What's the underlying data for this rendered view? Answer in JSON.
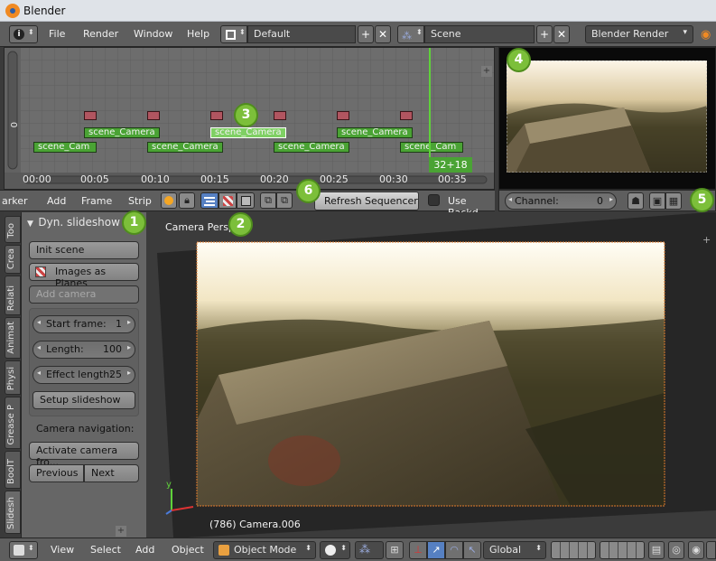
{
  "window": {
    "title": "Blender"
  },
  "info_header": {
    "menus": [
      "File",
      "Render",
      "Window",
      "Help"
    ],
    "screen_layout": "Default",
    "scene": "Scene",
    "render_engine": "Blender Render"
  },
  "sequencer": {
    "strip_label": "scene_Camera",
    "strip_label_short": "scene_Cam",
    "time_ticks": [
      "00:00",
      "00:05",
      "00:10",
      "00:15",
      "00:20",
      "00:25",
      "00:30",
      "00:35"
    ],
    "current_frame_label": "32+18",
    "channel_label": "0"
  },
  "sequencer_header": {
    "menus": [
      "arker",
      "Add",
      "Frame",
      "Strip"
    ],
    "refresh_label": "Refresh Sequencer",
    "use_backdrop_label": "Use Backd"
  },
  "preview_header": {
    "channel_label": "Channel:",
    "channel_value": "0"
  },
  "tool_shelf": {
    "tabs": [
      "Too",
      "Crea",
      "Relati",
      "Animat",
      "Physi",
      "Grease P",
      "BoolT",
      "Slidesh"
    ],
    "panel_title": "Dyn. slideshow",
    "init_scene": "Init scene",
    "images_as_planes": "Images as Planes",
    "add_camera": "Add camera",
    "start_frame_label": "Start frame:",
    "start_frame_value": "1",
    "length_label": "Length:",
    "length_value": "100",
    "effect_length_label": "Effect length:",
    "effect_length_value": "25",
    "setup_slideshow": "Setup slideshow",
    "camera_nav_label": "Camera navigation:",
    "activate_camera": "Activate camera fro...",
    "previous": "Previous",
    "next": "Next"
  },
  "viewport": {
    "view_label": "Camera Persp",
    "object_info": "(786) Camera.006",
    "axis_y": "y"
  },
  "bottom_header": {
    "menus": [
      "View",
      "Select",
      "Add",
      "Object"
    ],
    "mode": "Object Mode",
    "orientation": "Global"
  },
  "callouts": [
    "1",
    "2",
    "3",
    "4",
    "5",
    "6"
  ],
  "colors": {
    "strip": "#4aa334",
    "playhead": "#5fd13a",
    "badge": "#7cbf3a",
    "marker": "#b15560"
  }
}
